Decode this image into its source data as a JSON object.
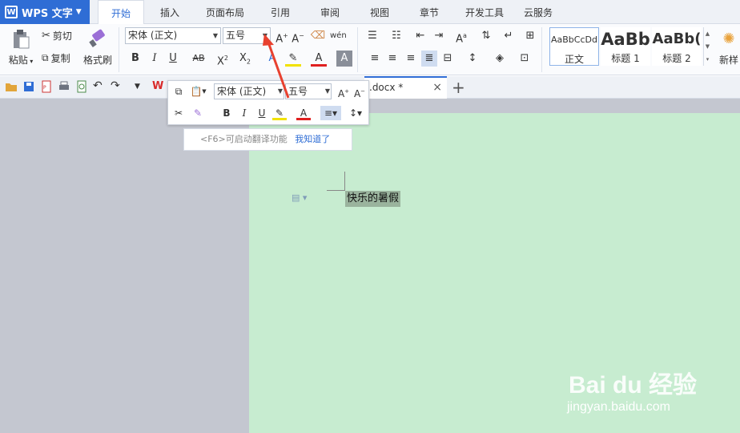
{
  "app": {
    "name": "WPS 文字"
  },
  "menu": {
    "tabs": [
      "开始",
      "插入",
      "页面布局",
      "引用",
      "审阅",
      "视图",
      "章节",
      "开发工具",
      "云服务"
    ]
  },
  "ribbon": {
    "paste": "粘贴",
    "cut": "剪切",
    "copy": "复制",
    "format_painter": "格式刷",
    "font_name": "宋体 (正文)",
    "font_size": "五号",
    "styles": [
      {
        "preview": "AaBbCcDd",
        "label": "正文"
      },
      {
        "preview": "AaBb",
        "label": "标题 1"
      },
      {
        "preview": "AaBb(",
        "label": "标题 2"
      }
    ],
    "new_style": "新样"
  },
  "mini_toolbar": {
    "font_name": "宋体 (正文)",
    "font_size": "五号"
  },
  "tip": {
    "text": "<F6>可启动翻译功能",
    "link": "我知道了"
  },
  "document": {
    "tab_title": ".docx *",
    "selected_text": "快乐的暑假"
  },
  "watermark": {
    "brand": "Bai du 经验",
    "url": "jingyan.baidu.com"
  },
  "colors": {
    "accent": "#2f6dd5",
    "page": "#c7ecd0",
    "workspace": "#c4c7d0",
    "annotation_arrow": "#e8412f"
  }
}
